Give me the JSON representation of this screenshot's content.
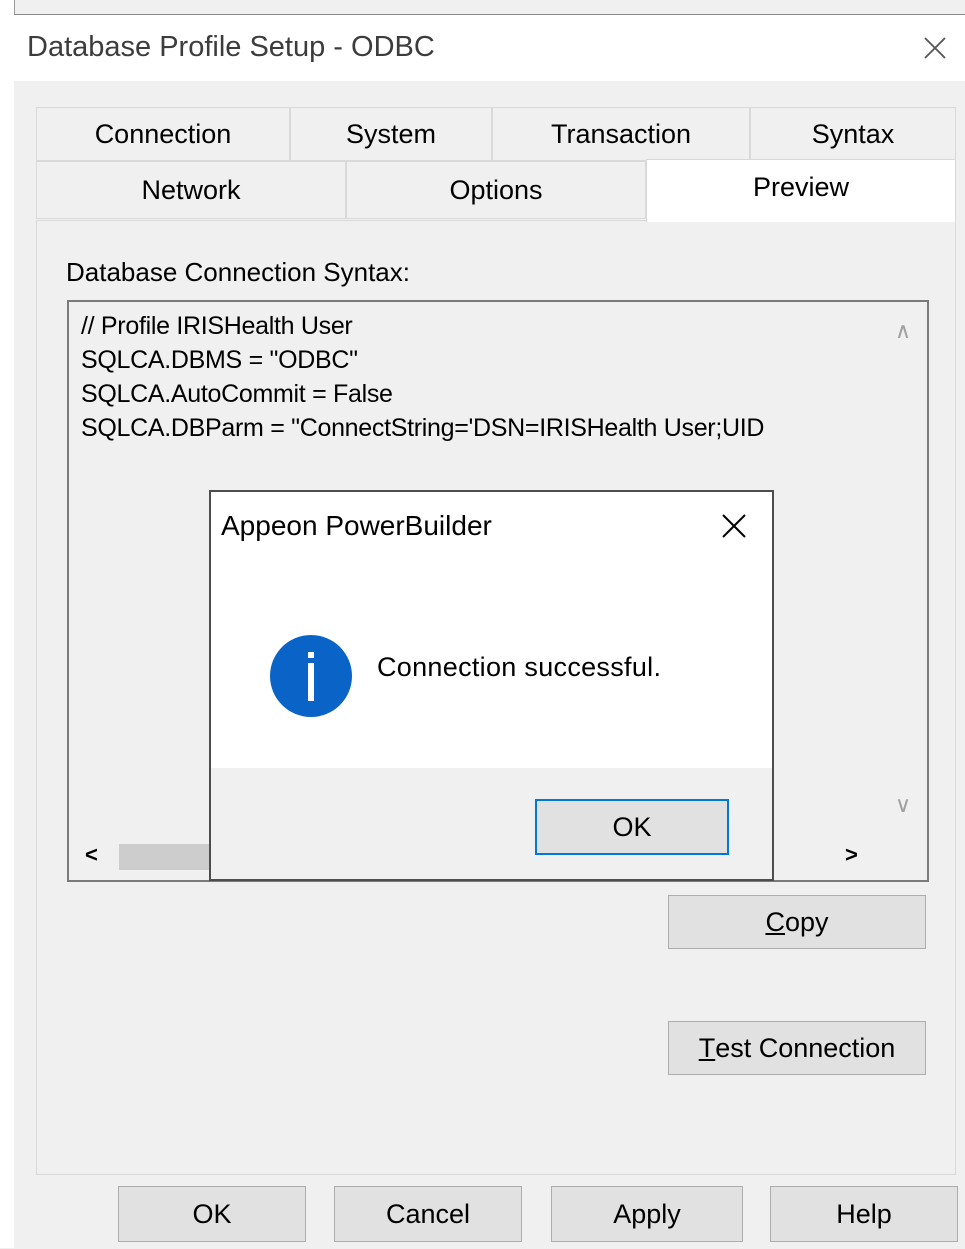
{
  "window": {
    "title": "Database Profile Setup - ODBC"
  },
  "tabs": {
    "row1": [
      "Connection",
      "System",
      "Transaction",
      "Syntax"
    ],
    "row2": [
      "Network",
      "Options",
      "Preview"
    ],
    "active": "Preview"
  },
  "preview": {
    "label": "Database Connection Syntax:",
    "lines": [
      "// Profile IRISHealth User",
      "SQLCA.DBMS = \"ODBC\"",
      "SQLCA.AutoCommit = False",
      "SQLCA.DBParm = \"ConnectString='DSN=IRISHealth User;UID"
    ],
    "copy_button": {
      "mnemonic": "C",
      "rest": "opy"
    },
    "test_button": {
      "mnemonic": "T",
      "rest": "est Connection"
    }
  },
  "footer_buttons": {
    "ok": "OK",
    "cancel": "Cancel",
    "apply": "Apply",
    "help": "Help"
  },
  "dialog": {
    "title": "Appeon PowerBuilder",
    "message": "Connection successful.",
    "icon": "info-icon",
    "icon_glyph": "i",
    "ok_label": "OK"
  },
  "colors": {
    "info_icon": "#0a64c8",
    "focus_border": "#0078d7"
  }
}
